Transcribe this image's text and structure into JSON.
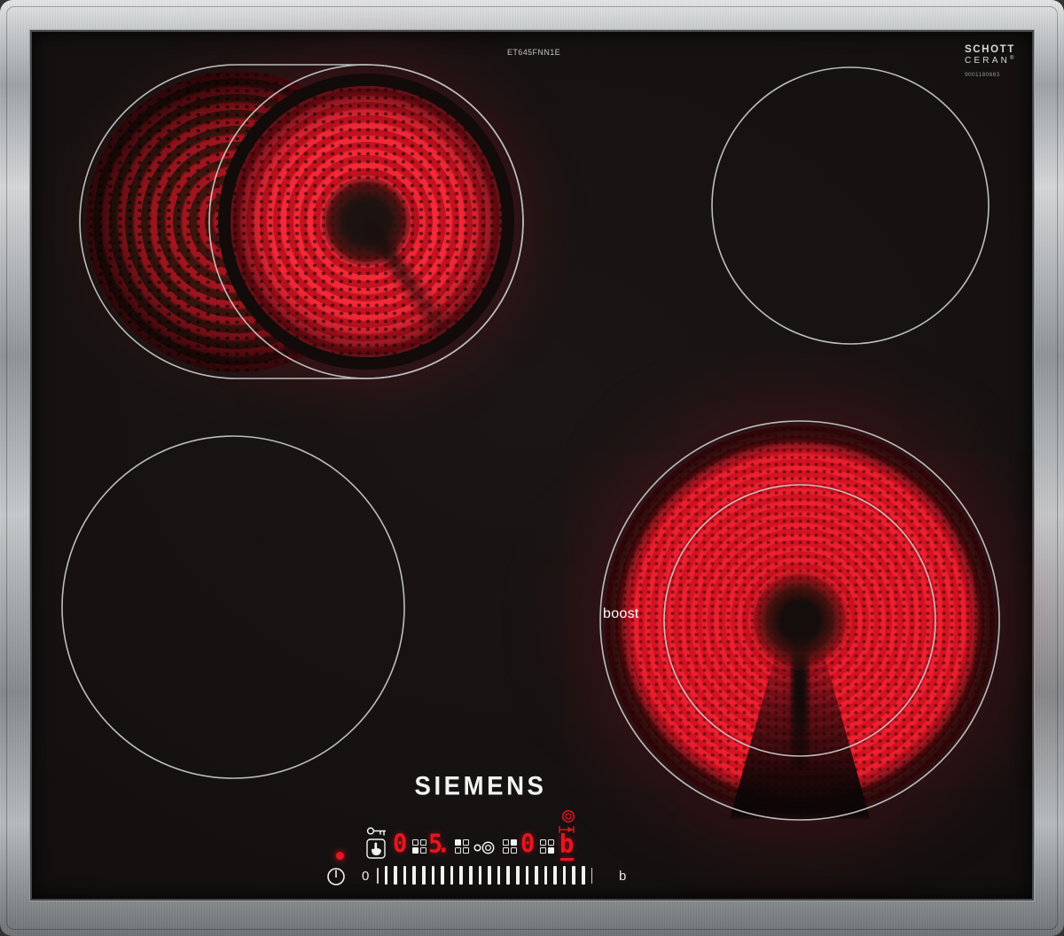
{
  "branding": {
    "logo": "SIEMENS",
    "model": "ET645FNN1E",
    "glass": {
      "line1": "SCHOTT",
      "line2": "CERAN",
      "reg": "®",
      "serial": "9001180663"
    }
  },
  "zones": {
    "rear_left": {
      "type": "dual extendable roaster zone",
      "state": "heating"
    },
    "rear_right": {
      "type": "single zone",
      "state": "off"
    },
    "front_left": {
      "type": "single zone",
      "state": "off"
    },
    "front_right": {
      "type": "dual-ring zone",
      "state": "boost",
      "label": "boost"
    }
  },
  "control_panel": {
    "indicator_dot": "on",
    "icons": {
      "lock": "key-lock-icon",
      "touch": "hand-touch-icon",
      "dual_zone": "dual-zone-icon",
      "power": "power-icon",
      "dual_ring": "dual-ring-icon",
      "extension": "zone-extension-icon"
    },
    "displays": [
      {
        "zone": "front-left",
        "value": "0",
        "grid": "bl"
      },
      {
        "zone": "rear-left",
        "value": "5.",
        "grid": "tl"
      },
      {
        "zone": "rear-right",
        "value": "0",
        "grid": "tr"
      },
      {
        "zone": "front-right",
        "value": "b",
        "grid": "br",
        "underline": true
      }
    ],
    "slider": {
      "start_label": "0",
      "end_label": "b",
      "lead_ticks": 1,
      "main_ticks": 22,
      "trail_ticks": 1
    }
  },
  "colors": {
    "steel": "#b0b4b7",
    "glass": "#171313",
    "outline": "#cdd0d1",
    "glow": "#e81829",
    "display": "#ea1420",
    "white": "#f1f2f2"
  }
}
